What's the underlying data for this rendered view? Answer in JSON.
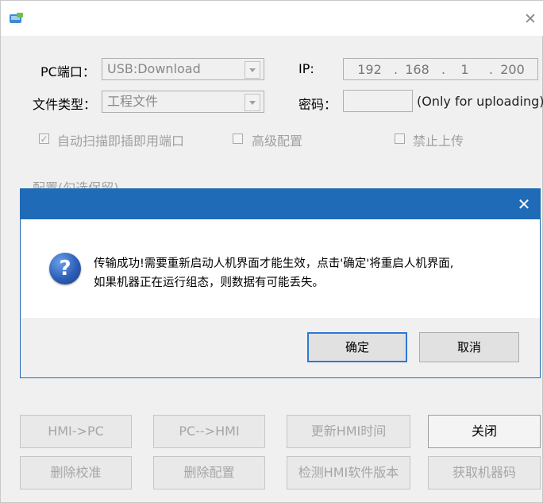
{
  "main": {
    "port_label": "PC端口：",
    "port_value": "USB:Download",
    "ip_label": "IP:",
    "ip_octets": [
      "192",
      "168",
      "1",
      "200"
    ],
    "filetype_label": "文件类型：",
    "filetype_value": "工程文件",
    "password_label": "密码：",
    "password_note": "(Only for uploading)",
    "checkboxes": [
      {
        "label": "自动扫描即插即用端口",
        "checked": true
      },
      {
        "label": "高级配置",
        "checked": false
      },
      {
        "label": "禁止上传",
        "checked": false
      }
    ],
    "group_label_partial": "配置(勾选保留)",
    "buttons_row1": [
      "HMI->PC",
      "PC-->HMI",
      "更新HMI时间",
      "关闭"
    ],
    "buttons_row2": [
      "删除校准",
      "删除配置",
      "检测HMI软件版本",
      "获取机器码"
    ]
  },
  "dialog": {
    "message_line1": "传输成功!需要重新启动人机界面才能生效，点击'确定'将重启人机界面,",
    "message_line2": "如果机器正在运行组态，则数据有可能丢失。",
    "ok_label": "确定",
    "cancel_label": "取消",
    "close_glyph": "✕",
    "icon_glyph": "?"
  },
  "window": {
    "close_glyph": "✕"
  },
  "colors": {
    "dialog_titlebar": "#1f6bb7",
    "window_bg": "#f0f0f0",
    "default_button_border": "#2f78d4"
  }
}
